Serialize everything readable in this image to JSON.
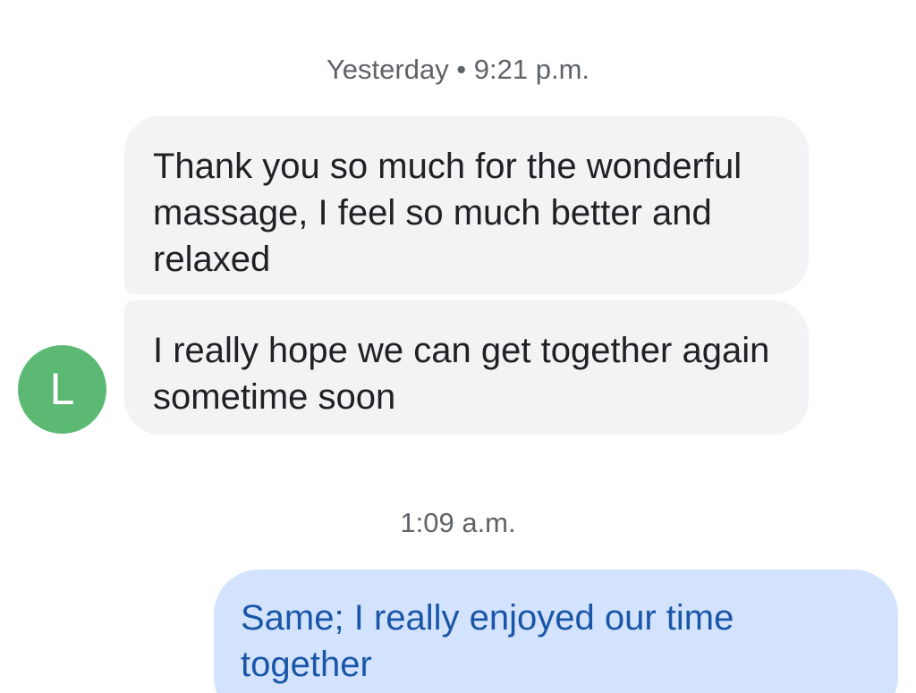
{
  "thread": {
    "timestamp_1": "Yesterday • 9:21 p.m.",
    "timestamp_2": "1:09 a.m.",
    "contact": {
      "initial": "L",
      "avatar_color": "#5bb974"
    },
    "messages": [
      {
        "direction": "incoming",
        "text": "Thank you so much for the wonderful massage, I feel so much better and relaxed"
      },
      {
        "direction": "incoming",
        "text": "I really hope we can get together again sometime soon"
      },
      {
        "direction": "outgoing",
        "text": "Same; I really enjoyed our time together"
      }
    ]
  }
}
